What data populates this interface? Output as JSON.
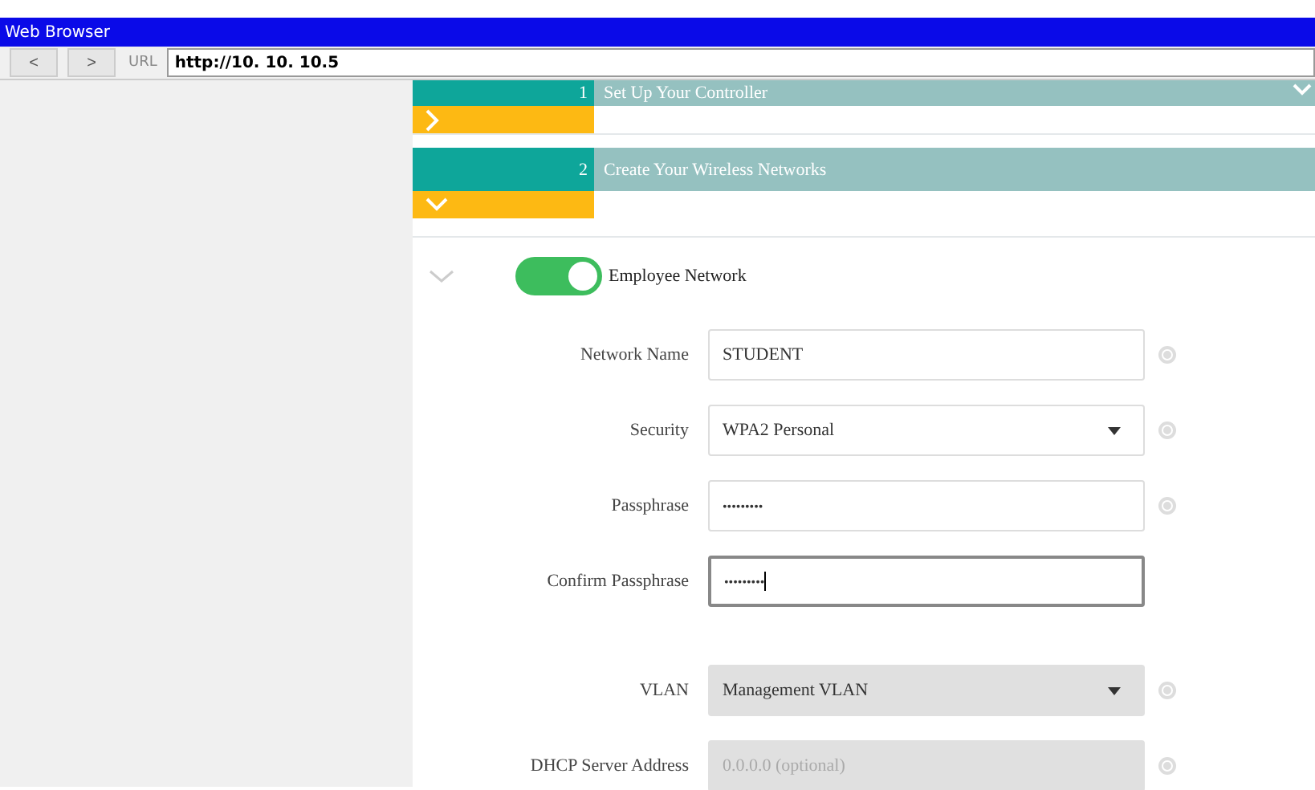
{
  "window": {
    "title": "Web Browser"
  },
  "nav": {
    "back": "<",
    "forward": ">",
    "url_label": "URL",
    "url": "http://10. 10. 10.5"
  },
  "steps": [
    {
      "number": "1",
      "title": "Set Up Your Controller",
      "expanded": false
    },
    {
      "number": "2",
      "title": "Create Your Wireless Networks",
      "expanded": true
    }
  ],
  "network": {
    "name": "Employee Network",
    "on": true,
    "expanded": true,
    "fields": [
      {
        "label": "Network Name",
        "kind": "text",
        "value": "STUDENT",
        "disabled": false,
        "focused": false
      },
      {
        "label": "Security",
        "kind": "select",
        "value": "WPA2 Personal",
        "disabled": false,
        "focused": false
      },
      {
        "label": "Passphrase",
        "kind": "password",
        "value": "•••••••••",
        "disabled": false,
        "focused": false
      },
      {
        "label": "Confirm Passphrase",
        "kind": "password",
        "value": "•••••••••",
        "disabled": false,
        "focused": true
      },
      {
        "label": "VLAN",
        "kind": "select",
        "value": "Management VLAN",
        "disabled": true,
        "focused": false
      },
      {
        "label": "DHCP Server Address",
        "kind": "text",
        "placeholder": "0.0.0.0 (optional)",
        "disabled": true,
        "focused": false
      }
    ]
  }
}
